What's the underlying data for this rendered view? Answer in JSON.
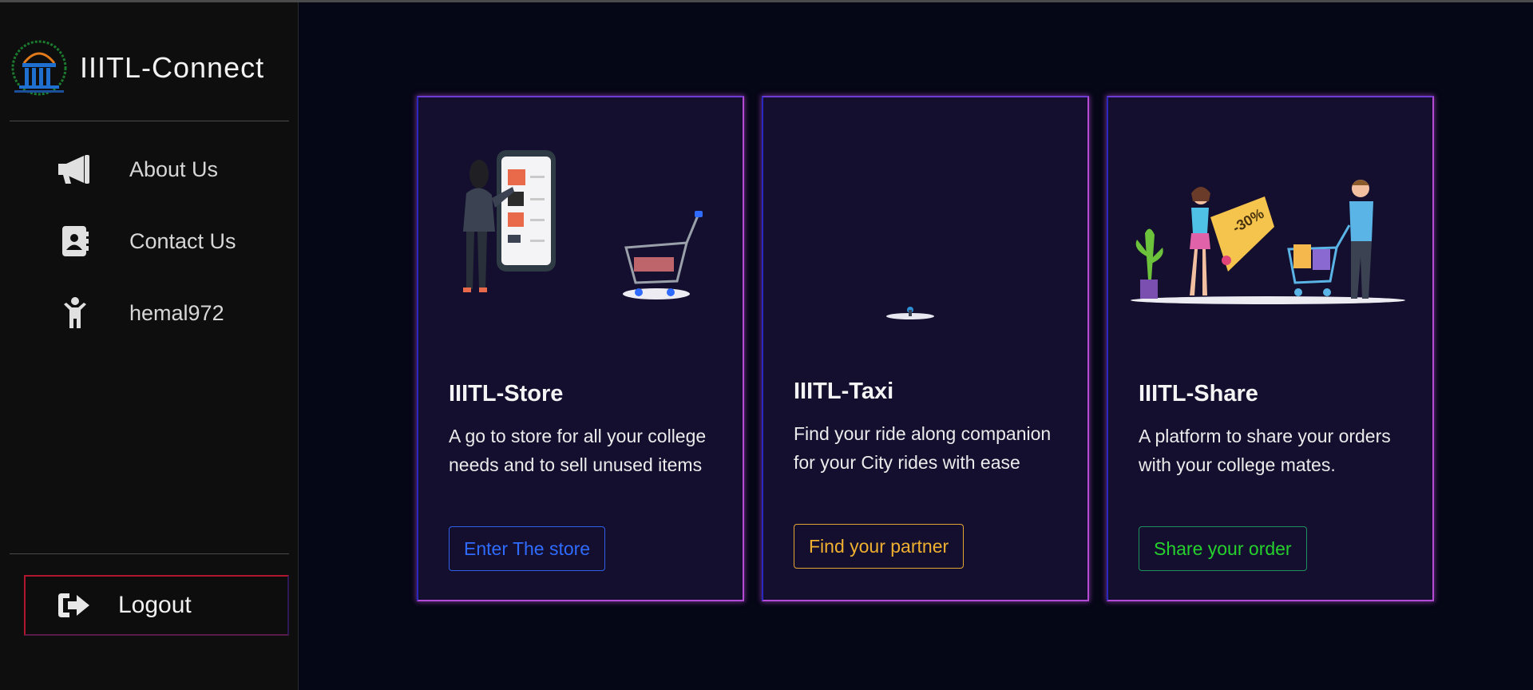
{
  "sidebar": {
    "brand": {
      "title": "IIITL-Connect"
    },
    "items": [
      {
        "label": "About Us",
        "icon": "megaphone-icon"
      },
      {
        "label": "Contact Us",
        "icon": "contact-card-icon"
      },
      {
        "label": "hemal972",
        "icon": "person-icon"
      }
    ],
    "logout": {
      "label": "Logout",
      "icon": "sign-out-icon"
    }
  },
  "cards": [
    {
      "title": "IIITL-Store",
      "description": "A go to store for all your college needs and to sell unused items",
      "button": "Enter The store",
      "accent": "#2f6bff"
    },
    {
      "title": "IIITL-Taxi",
      "description": "Find your ride along companion for your City rides with ease",
      "button": "Find your partner",
      "accent": "#f0b030"
    },
    {
      "title": "IIITL-Share",
      "description": "A platform to share your orders with your college mates.",
      "button": "Share your order",
      "accent": "#26d12e",
      "illustration_tag": "-30%"
    }
  ],
  "colors": {
    "background": "#050616",
    "sidebar": "#0e0e0e",
    "card": "#140f2e",
    "card_border": "#b44ad6",
    "logout_border": "#b0162d"
  }
}
